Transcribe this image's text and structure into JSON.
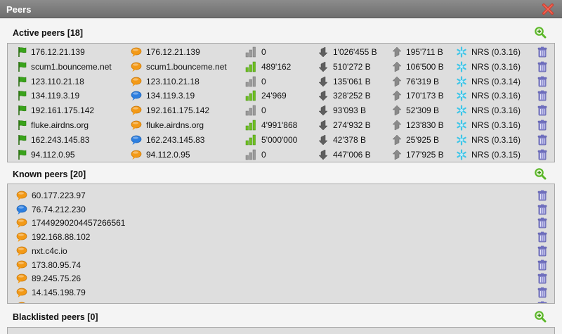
{
  "window": {
    "title": "Peers",
    "close_icon": "close-icon"
  },
  "active": {
    "title": "Active peers [18]",
    "rows": [
      {
        "addr": "176.12.21.139",
        "host": "176.12.21.139",
        "chat": "orange",
        "bars": "gray",
        "weight": "0",
        "down": "1'026'455 B",
        "up": "195'711 B",
        "version": "NRS (0.3.16)"
      },
      {
        "addr": "scum1.bounceme.net",
        "host": "scum1.bounceme.net",
        "chat": "orange",
        "bars": "green",
        "weight": "489'162",
        "down": "510'272 B",
        "up": "106'500 B",
        "version": "NRS (0.3.16)"
      },
      {
        "addr": "123.110.21.18",
        "host": "123.110.21.18",
        "chat": "orange",
        "bars": "gray",
        "weight": "0",
        "down": "135'061 B",
        "up": "76'319 B",
        "version": "NRS (0.3.14)"
      },
      {
        "addr": "134.119.3.19",
        "host": "134.119.3.19",
        "chat": "blue",
        "bars": "green",
        "weight": "24'969",
        "down": "328'252 B",
        "up": "170'173 B",
        "version": "NRS (0.3.16)"
      },
      {
        "addr": "192.161.175.142",
        "host": "192.161.175.142",
        "chat": "orange",
        "bars": "gray",
        "weight": "0",
        "down": "93'093 B",
        "up": "52'309 B",
        "version": "NRS (0.3.16)"
      },
      {
        "addr": "fluke.airdns.org",
        "host": "fluke.airdns.org",
        "chat": "orange",
        "bars": "green",
        "weight": "4'991'868",
        "down": "274'932 B",
        "up": "123'830 B",
        "version": "NRS (0.3.16)"
      },
      {
        "addr": "162.243.145.83",
        "host": "162.243.145.83",
        "chat": "blue",
        "bars": "green",
        "weight": "5'000'000",
        "down": "42'378 B",
        "up": "25'925 B",
        "version": "NRS (0.3.16)"
      },
      {
        "addr": "94.112.0.95",
        "host": "94.112.0.95",
        "chat": "orange",
        "bars": "gray",
        "weight": "0",
        "down": "447'006 B",
        "up": "177'925 B",
        "version": "NRS (0.3.15)"
      },
      {
        "addr": "",
        "host": "",
        "chat": "orange",
        "bars": "green",
        "weight": "",
        "down": "",
        "up": "",
        "version": ""
      }
    ]
  },
  "known": {
    "title": "Known peers [20]",
    "rows": [
      {
        "addr": "60.177.223.97",
        "chat": "orange"
      },
      {
        "addr": "76.74.212.230",
        "chat": "blue"
      },
      {
        "addr": "17449290204457266561",
        "chat": "orange"
      },
      {
        "addr": "192.168.88.102",
        "chat": "orange"
      },
      {
        "addr": "nxt.c4c.io",
        "chat": "orange"
      },
      {
        "addr": "173.80.95.74",
        "chat": "orange"
      },
      {
        "addr": "89.245.75.26",
        "chat": "orange"
      },
      {
        "addr": "14.145.198.79",
        "chat": "orange"
      },
      {
        "addr": "",
        "chat": "orange"
      }
    ]
  },
  "blacklisted": {
    "title": "Blacklisted peers [0]"
  },
  "colors": {
    "flag": "#3aa31c",
    "chat_orange": "#f39a17",
    "chat_blue": "#2d7fe0",
    "bars_green": "#6fbf1f",
    "bars_gray": "#9a9a9a",
    "arrow": "#666666",
    "nrs": "#3ec6e8",
    "trash": "#5a5aa8",
    "zoom": "#5cb82a",
    "close": "#d23a2a"
  }
}
